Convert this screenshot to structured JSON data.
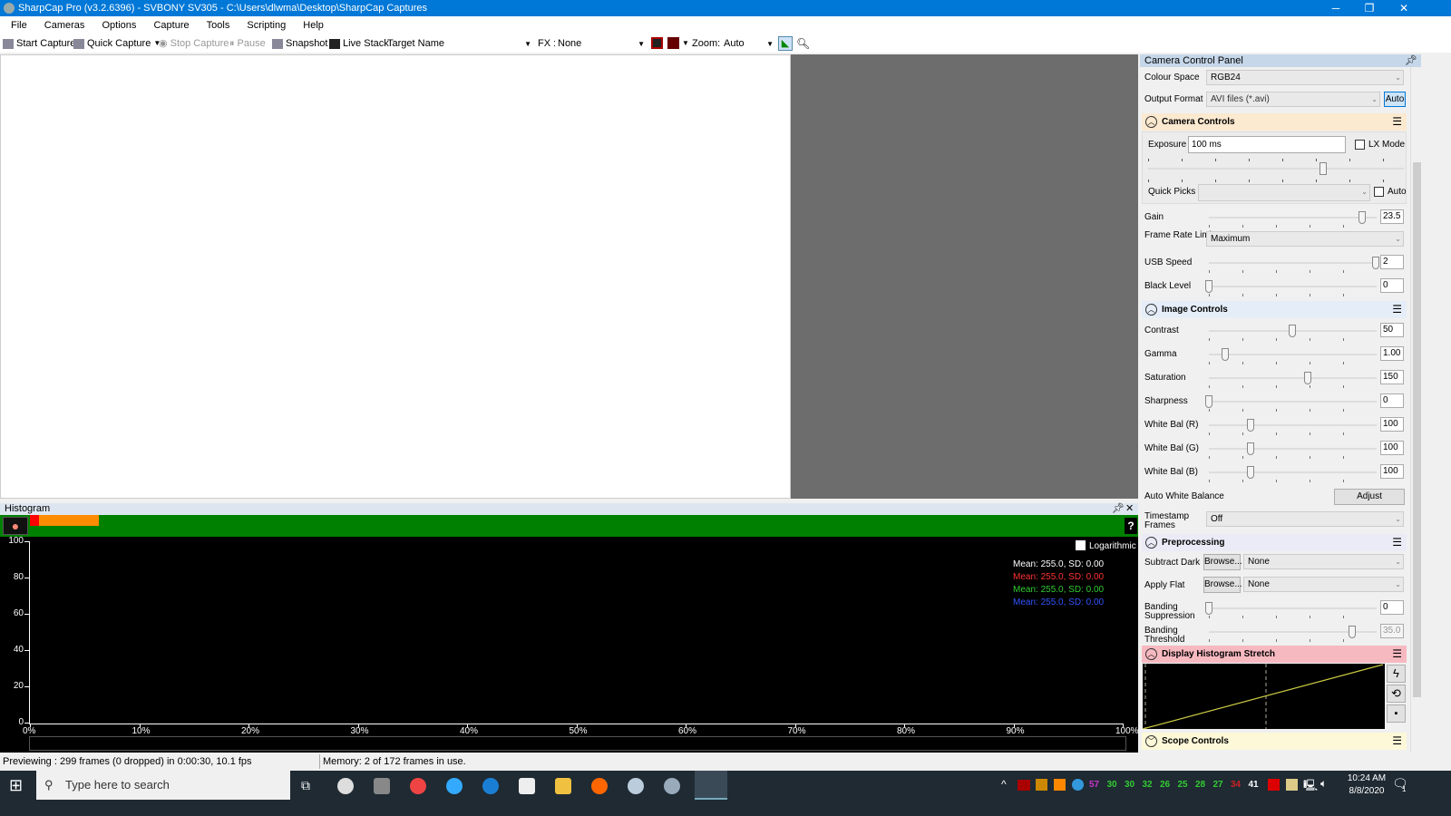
{
  "window": {
    "title": "SharpCap Pro (v3.2.6396) - SVBONY SV305 - C:\\Users\\dlwma\\Desktop\\SharpCap Captures",
    "minimize": "─",
    "restore": "❐",
    "close": "✕"
  },
  "menu": [
    "File",
    "Cameras",
    "Options",
    "Capture",
    "Tools",
    "Scripting",
    "Help"
  ],
  "toolbar": {
    "start_capture": "Start Capture",
    "quick_capture": "Quick Capture",
    "stop_capture": "Stop Capture",
    "pause": "Pause",
    "snapshot": "Snapshot",
    "live_stack": "Live Stack",
    "target_name_label": "Target Name :",
    "target_name_value": "",
    "fx_label": "FX :",
    "fx_value": "None",
    "zoom_label": "Zoom:",
    "zoom_value": "Auto"
  },
  "histogram": {
    "title": "Histogram",
    "help": "?",
    "logarithmic_label": "Logarithmic",
    "logarithmic_checked": false,
    "y_ticks": [
      "100",
      "80",
      "60",
      "40",
      "20",
      "0"
    ],
    "x_ticks": [
      "0%",
      "10%",
      "20%",
      "30%",
      "40%",
      "50%",
      "60%",
      "70%",
      "80%",
      "90%",
      "100%"
    ],
    "stats": [
      {
        "text": "Mean: 255.0, SD: 0.00",
        "color": "#ffffff"
      },
      {
        "text": "Mean: 255.0, SD: 0.00",
        "color": "#ff3333"
      },
      {
        "text": "Mean: 255.0, SD: 0.00",
        "color": "#33cc33"
      },
      {
        "text": "Mean: 255.0, SD: 0.00",
        "color": "#3355ff"
      }
    ],
    "bar_colors": {
      "background": "#008000",
      "red": "#ff0000",
      "orange": "#ff8c00"
    }
  },
  "status": {
    "preview": "Previewing : 299 frames (0 dropped) in 0:00:30, 10.1 fps",
    "memory": "Memory: 2 of 172 frames in use."
  },
  "panel": {
    "title": "Camera Control Panel",
    "colour_space_label": "Colour Space",
    "colour_space": "RGB24",
    "output_format_label": "Output Format",
    "output_format": "AVI files (*.avi)",
    "auto_button": "Auto",
    "camera_controls": "Camera Controls",
    "exposure_label": "Exposure",
    "exposure": "100 ms",
    "lx_mode": "LX Mode",
    "quick_picks_label": "Quick Picks",
    "quick_picks": "",
    "quick_auto": "Auto",
    "frame_rate_label": "Frame Rate Limit",
    "frame_rate": "Maximum",
    "image_controls": "Image Controls",
    "auto_wb_label": "Auto White Balance",
    "adjust_button": "Adjust",
    "timestamp_label": "Timestamp Frames",
    "timestamp": "Off",
    "preprocessing": "Preprocessing",
    "subtract_dark_label": "Subtract Dark",
    "apply_flat_label": "Apply Flat",
    "browse": "Browse...",
    "subtract_dark": "None",
    "apply_flat": "None",
    "display_stretch": "Display Histogram Stretch",
    "scope_controls": "Scope Controls",
    "sliders": [
      {
        "label": "Gain",
        "value": "23.5",
        "level": 0.92
      },
      {
        "label": "USB Speed",
        "value": "2",
        "level": 1.0
      },
      {
        "label": "Black Level",
        "value": "0",
        "level": 0
      },
      {
        "label": "Contrast",
        "value": "50",
        "level": 0.5
      },
      {
        "label": "Gamma",
        "value": "1.00",
        "level": 0.1
      },
      {
        "label": "Saturation",
        "value": "150",
        "level": 0.59
      },
      {
        "label": "Sharpness",
        "value": "0",
        "level": 0
      },
      {
        "label": "White Bal (R)",
        "value": "100",
        "level": 0.25
      },
      {
        "label": "White Bal (G)",
        "value": "100",
        "level": 0.25
      },
      {
        "label": "White Bal (B)",
        "value": "100",
        "level": 0.25
      },
      {
        "label": "Banding Suppression",
        "value": "0",
        "level": 0
      },
      {
        "label": "Banding Threshold",
        "value": "35.0",
        "level": 0.86,
        "disabled": true
      }
    ]
  },
  "taskbar": {
    "search_placeholder": "Type here to search",
    "time": "10:24 AM",
    "date": "8/8/2020",
    "notifications": "1",
    "tray_numbers": [
      {
        "t": "57",
        "c": "#cc33cc"
      },
      {
        "t": "30",
        "c": "#33cc33"
      },
      {
        "t": "30",
        "c": "#33cc33"
      },
      {
        "t": "32",
        "c": "#33cc33"
      },
      {
        "t": "26",
        "c": "#33cc33"
      },
      {
        "t": "25",
        "c": "#33cc33"
      },
      {
        "t": "28",
        "c": "#33cc33"
      },
      {
        "t": "27",
        "c": "#33cc33"
      },
      {
        "t": "34",
        "c": "#cc2222"
      },
      {
        "t": "41",
        "c": "#ffffff"
      }
    ]
  }
}
